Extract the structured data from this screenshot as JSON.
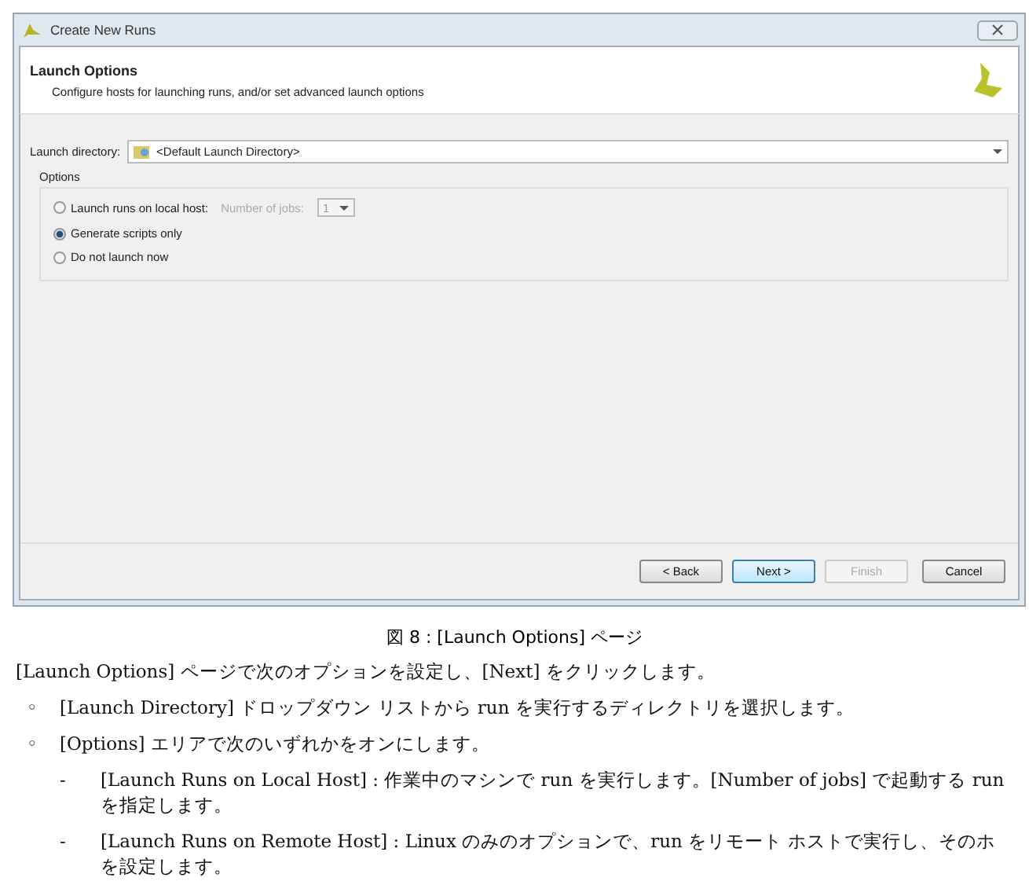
{
  "dialog": {
    "title": "Create New Runs",
    "header": {
      "title": "Launch Options",
      "subtitle": "Configure hosts for launching runs, and/or set advanced launch options"
    },
    "launch_directory": {
      "label": "Launch directory:",
      "value": "<Default Launch Directory>"
    },
    "options": {
      "title": "Options",
      "items": [
        {
          "label": "Launch runs on local host:",
          "selected": false,
          "jobs": {
            "label": "Number of jobs:",
            "value": "1",
            "disabled": true
          }
        },
        {
          "label": "Generate scripts only",
          "selected": true
        },
        {
          "label": "Do not launch now",
          "selected": false
        }
      ]
    },
    "buttons": [
      {
        "label": "< Back",
        "default": false,
        "disabled": false
      },
      {
        "label": "Next >",
        "default": true,
        "disabled": false
      },
      {
        "label": "Finish",
        "default": false,
        "disabled": true
      },
      {
        "label": "Cancel",
        "default": false,
        "disabled": false
      }
    ]
  },
  "caption": "図 8 : [Launch Options] ページ",
  "paragraphs": [
    {
      "kind": "para",
      "lines": [
        "[Launch Options] ページで次のオプションを設定し、[Next] をクリックします。"
      ]
    },
    {
      "kind": "bullet",
      "marker": "◦",
      "lines": [
        "[Launch Directory] ドロップダウン リストから run を実行するディレクトリを選択します。"
      ]
    },
    {
      "kind": "bullet",
      "marker": "◦",
      "lines": [
        "[Options] エリアで次のいずれかをオンにします。"
      ]
    },
    {
      "kind": "sub",
      "marker": "-",
      "lines": [
        "[Launch Runs on Local Host] : 作業中のマシンで run を実行します。[Number of jobs] で起動する run",
        "を指定します。"
      ]
    },
    {
      "kind": "sub",
      "marker": "-",
      "lines": [
        "[Launch Runs on Remote Host] : Linux のみのオプションで、run をリモート ホストで実行し、そのホ",
        "を設定します。"
      ]
    }
  ]
}
